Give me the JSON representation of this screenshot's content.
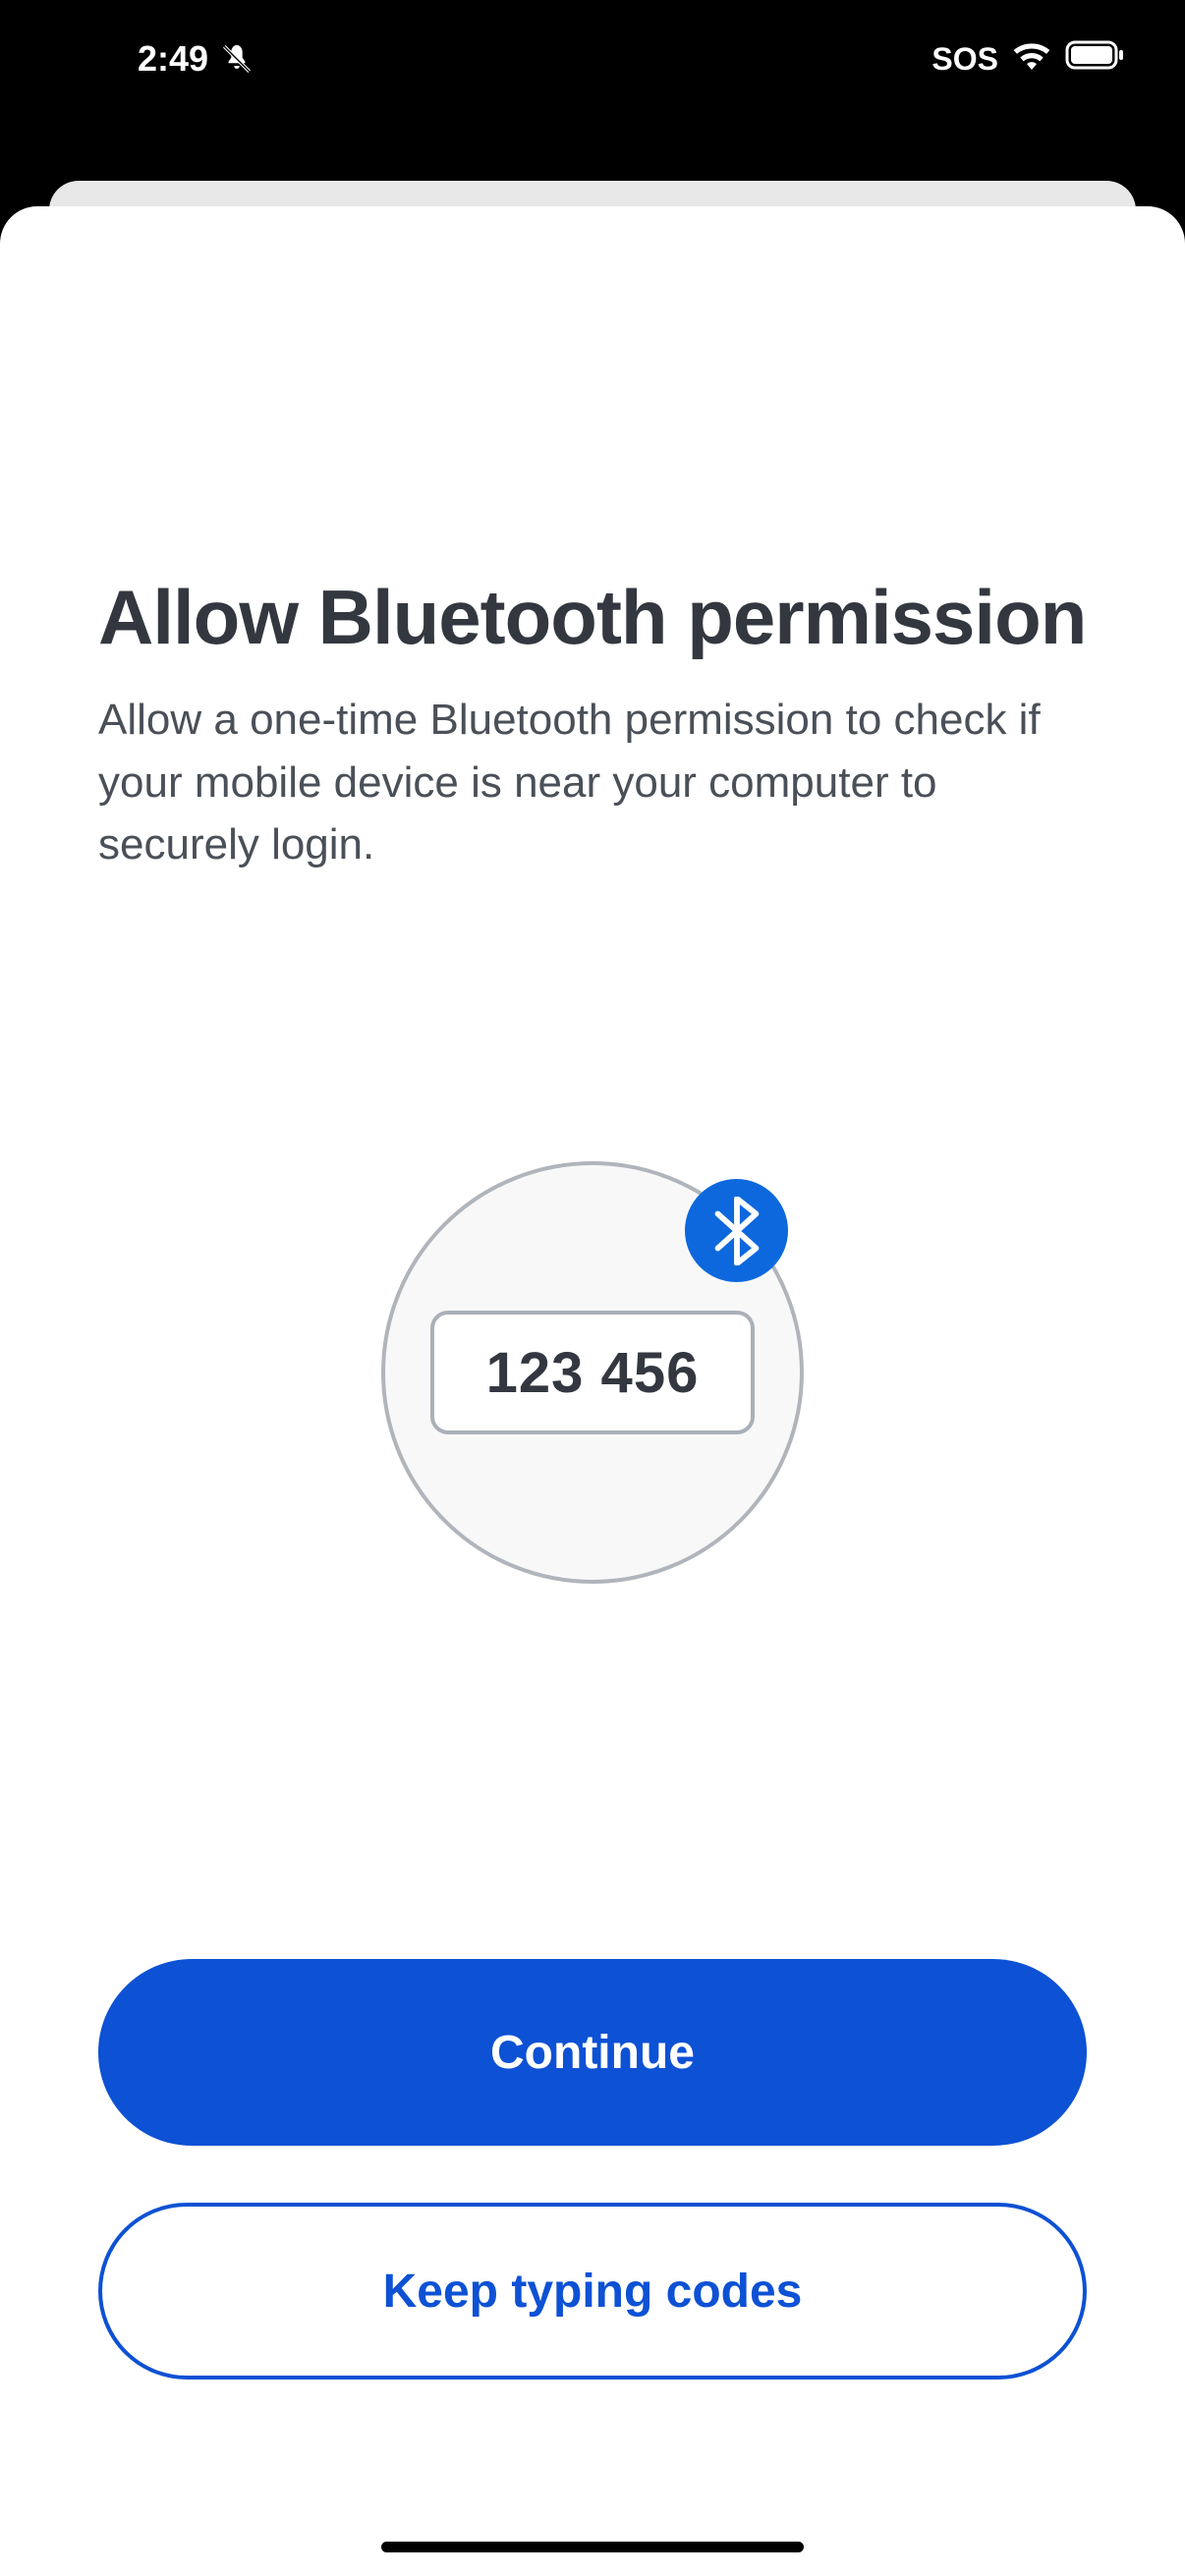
{
  "status_bar": {
    "time": "2:49",
    "sos_label": "SOS"
  },
  "sheet": {
    "title": "Allow Bluetooth permission",
    "subtitle": "Allow a one-time Bluetooth permission to check if your mobile device is near your computer to securely login.",
    "illustration_code": "123 456"
  },
  "buttons": {
    "primary": "Continue",
    "secondary": "Keep typing codes"
  }
}
